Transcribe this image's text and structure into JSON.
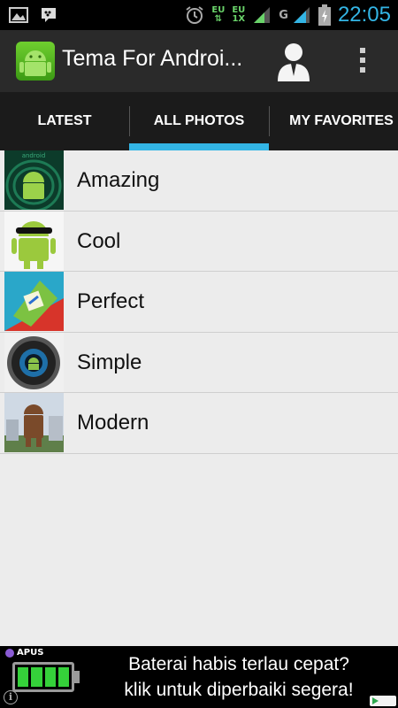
{
  "status_bar": {
    "net_top_1": "EU",
    "net_top_2": "EU",
    "net_bottom_2": "1X",
    "signal_type": "G",
    "time": "22:05"
  },
  "action_bar": {
    "title": "Tema For Androi...",
    "icons": [
      "app-icon",
      "profile-icon",
      "overflow-menu-icon"
    ]
  },
  "tabs": [
    {
      "label": "LATEST",
      "selected": false
    },
    {
      "label": "ALL PHOTOS",
      "selected": true
    },
    {
      "label": "MY FAVORITES",
      "selected": false
    }
  ],
  "list": [
    {
      "label": "Amazing"
    },
    {
      "label": "Cool"
    },
    {
      "label": "Perfect"
    },
    {
      "label": "Simple"
    },
    {
      "label": "Modern"
    }
  ],
  "ad": {
    "brand": "APUS",
    "line1": "Baterai habis terlau cepat?",
    "line2": "klik untuk diperbaiki segera!",
    "info": "i"
  },
  "colors": {
    "accent": "#33b5e5",
    "actionbar": "#2a2a2a",
    "tabbar": "#1b1b1b",
    "list_bg": "#ececec",
    "android_green": "#8bc34a"
  }
}
